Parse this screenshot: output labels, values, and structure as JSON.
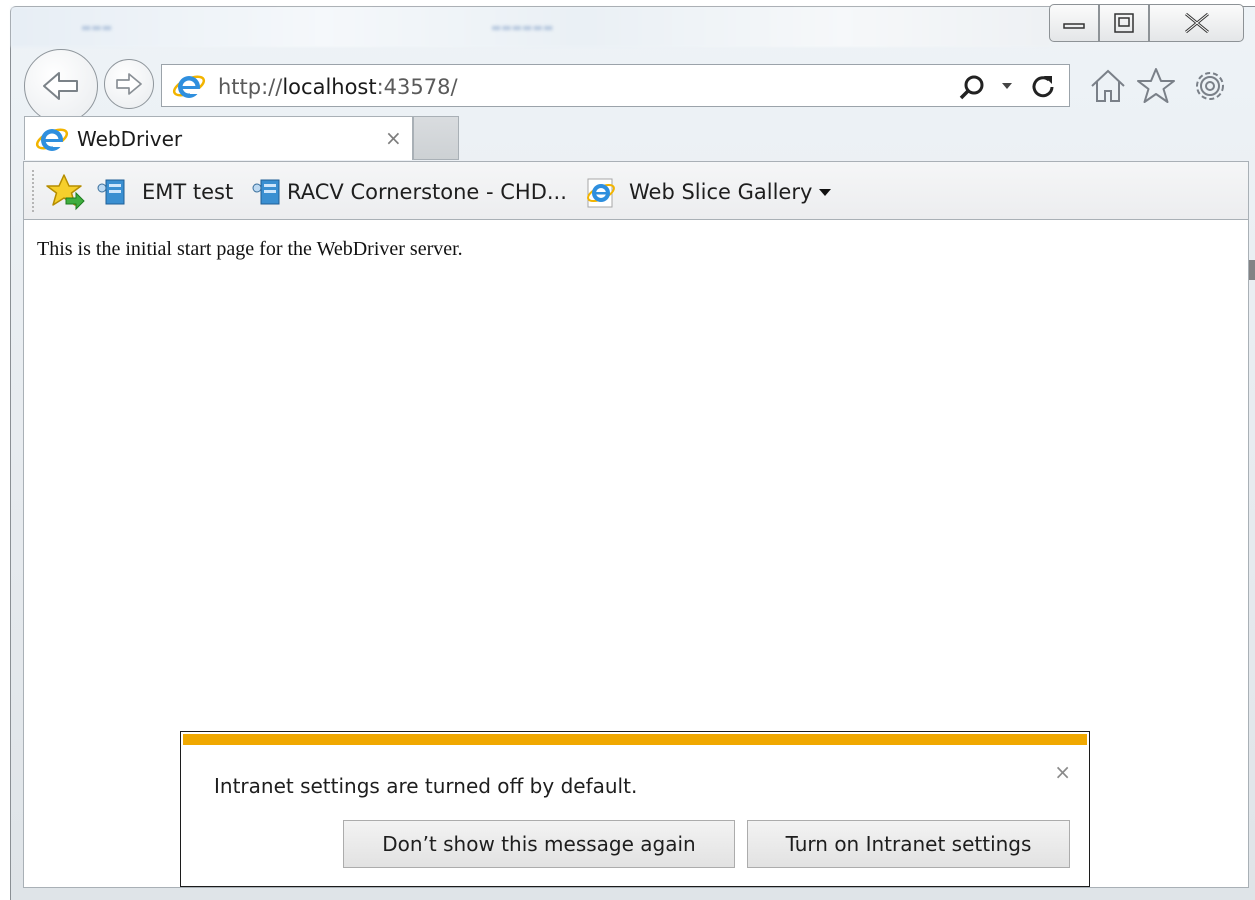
{
  "browser": {
    "window_controls": {
      "minimize": "minimize",
      "maximize": "maximize",
      "close": "close"
    },
    "address_bar": {
      "url_prefix": "http://",
      "url_host": "localhost",
      "url_suffix": ":43578/"
    },
    "tabs": [
      {
        "label": "WebDriver",
        "close": "×"
      }
    ],
    "favorites_bar": {
      "items": [
        {
          "label": "EMT test"
        },
        {
          "label": "RACV Cornerstone - CHD..."
        },
        {
          "label": "Web Slice Gallery"
        }
      ]
    },
    "icons": {
      "back": "back-arrow-icon",
      "forward": "forward-arrow-icon",
      "search": "search-icon",
      "refresh": "refresh-icon",
      "home": "home-icon",
      "favorites": "star-icon",
      "settings": "gear-icon"
    }
  },
  "page": {
    "content_text": "This is the initial start page for the WebDriver server."
  },
  "notification": {
    "message": "Intranet settings are turned off by default.",
    "close": "×",
    "buttons": {
      "dismiss": "Don’t show this message again",
      "enable": "Turn on Intranet settings"
    },
    "accent_color": "#f0a800"
  }
}
